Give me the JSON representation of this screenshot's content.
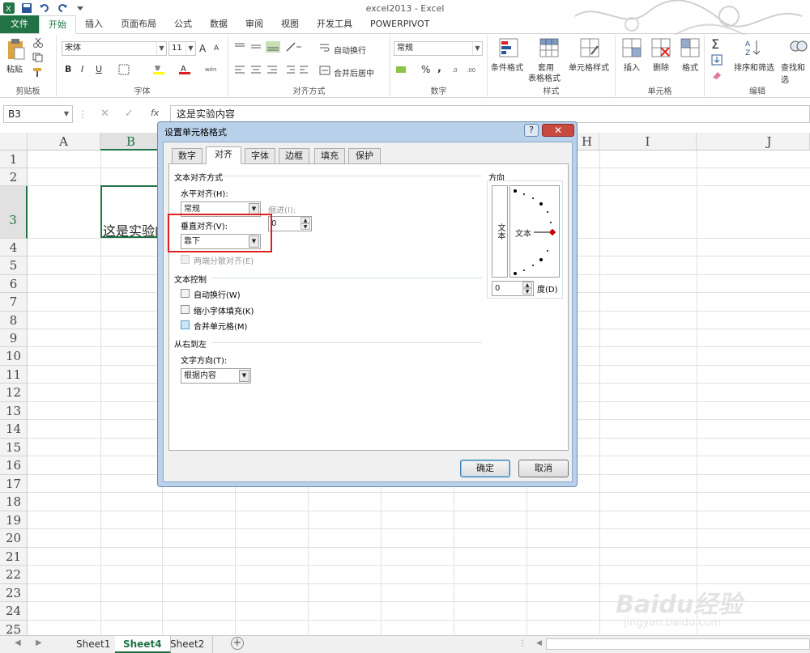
{
  "window": {
    "title": "excel2013 - Excel"
  },
  "ribbon_tabs": [
    "文件",
    "开始",
    "插入",
    "页面布局",
    "公式",
    "数据",
    "审阅",
    "视图",
    "开发工具",
    "POWERPIVOT"
  ],
  "clipboard": {
    "paste": "粘贴",
    "label": "剪贴板"
  },
  "font": {
    "name": "宋体",
    "size": "11",
    "label": "字体",
    "bold": "B",
    "italic": "I",
    "underline": "U",
    "grow": "A",
    "shrink": "A"
  },
  "alignment": {
    "wrap": "自动换行",
    "merge": "合并后居中",
    "label": "对齐方式"
  },
  "number": {
    "format": "常规",
    "percent": "%",
    "comma": ",",
    "label": "数字"
  },
  "styles": {
    "conditional": "条件格式",
    "table": "套用",
    "table2": "表格格式",
    "cell_styles": "单元格样式",
    "label": "样式"
  },
  "cells": {
    "insert": "插入",
    "delete": "删除",
    "format": "格式",
    "label": "单元格"
  },
  "editing": {
    "sort": "排序和筛选",
    "find": "查找和选",
    "label": "编辑",
    "sigma": "Σ"
  },
  "formula_bar": {
    "name_box": "B3",
    "content": "这是实验内容",
    "fx": "fx"
  },
  "columns": [
    "A",
    "B",
    "",
    "",
    "",
    "",
    "",
    "H",
    "I",
    "J"
  ],
  "rows": [
    "1",
    "2",
    "3",
    "4",
    "5",
    "6",
    "7",
    "8",
    "9",
    "10",
    "11",
    "12",
    "13",
    "14",
    "15",
    "16",
    "17",
    "18",
    "19",
    "20",
    "21",
    "22",
    "23",
    "24",
    "25"
  ],
  "cell_b3": "这是实验内容",
  "sheets": [
    "Sheet1",
    "Sheet4",
    "Sheet2"
  ],
  "active_sheet": "Sheet4",
  "dialog": {
    "title": "设置单元格格式",
    "help": "?",
    "close": "✕",
    "tabs": [
      "数字",
      "对齐",
      "字体",
      "边框",
      "填充",
      "保护"
    ],
    "active_tab": "对齐",
    "text_alignment": "文本对齐方式",
    "horizontal_label": "水平对齐(H):",
    "horizontal_value": "常规",
    "indent_label": "缩进(I):",
    "indent_value": "0",
    "vertical_label": "垂直对齐(V):",
    "vertical_value": "靠下",
    "justify_distributed": "两端分散对齐(E)",
    "text_control": "文本控制",
    "wrap_text": "自动换行(W)",
    "shrink_to_fit": "缩小字体填充(K)",
    "merge_cells": "合并单元格(M)",
    "rtl": "从右到左",
    "text_direction_label": "文字方向(T):",
    "text_direction_value": "根据内容",
    "orientation": "方向",
    "orientation_vertical_text": "文本",
    "orientation_text": "文本",
    "degree_value": "0",
    "degree_label": "度(D)",
    "ok": "确定",
    "cancel": "取消"
  },
  "colors": {
    "accent": "#217346",
    "highlight": "#e02020",
    "dialog_frame": "#b9d1ea"
  }
}
